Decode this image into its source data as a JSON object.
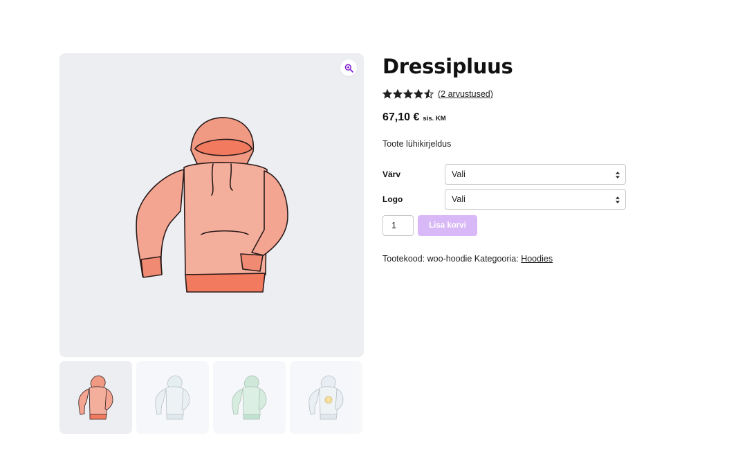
{
  "product": {
    "title": "Dressipluus",
    "rating": 4.5,
    "rating_max": 5,
    "review_link": "(2 arvustused)",
    "price": "67,10 €",
    "price_suffix": "sis. KM",
    "short_description": "Toote lühikirjeldus"
  },
  "variations": [
    {
      "label": "Värv",
      "selected": "Vali"
    },
    {
      "label": "Logo",
      "selected": "Vali"
    }
  ],
  "cart": {
    "quantity": "1",
    "add_button": "Lisa korvi",
    "button_color": "#d9b8f7"
  },
  "meta": {
    "sku_label": "Tootekood:",
    "sku": "woo-hoodie",
    "category_label": "Kategooria:",
    "category": "Hoodies"
  },
  "gallery": {
    "zoom_icon": "magnifier-plus-icon",
    "accent": "#7f1fd1",
    "thumbnails": [
      {
        "name": "hoodie-red",
        "color": "#f29a86"
      },
      {
        "name": "hoodie-blue",
        "color": "#dbe7ec"
      },
      {
        "name": "hoodie-green",
        "color": "#c9e6d6"
      },
      {
        "name": "hoodie-logo",
        "color": "#dbe3ea"
      }
    ]
  }
}
